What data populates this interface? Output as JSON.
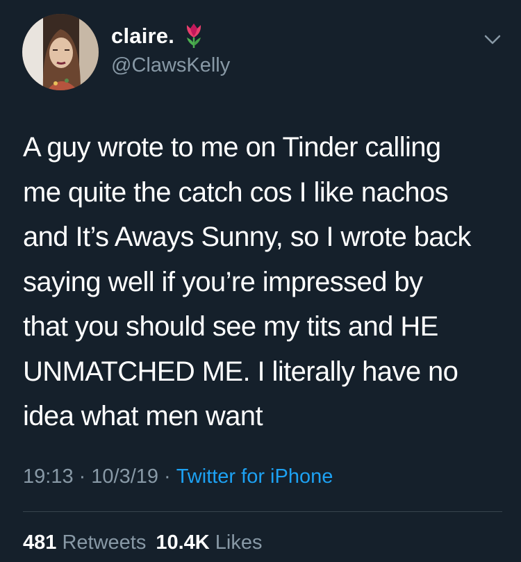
{
  "author": {
    "display_name": "claire.",
    "handle": "@ClawsKelly",
    "emoji_icon": "tulip-icon"
  },
  "tweet": {
    "lines": [
      "A guy wrote to me on Tinder calling",
      "me quite the catch cos I like nachos",
      "and It’s Aways Sunny, so I wrote back",
      "saying well if you’re impressed by",
      "that you should see my tits and HE",
      "UNMATCHED ME. I literally have no",
      "idea what men want"
    ]
  },
  "meta": {
    "time": "19:13",
    "date": "10/3/19",
    "separator": "·",
    "source": "Twitter for iPhone"
  },
  "stats": {
    "retweets_count": "481",
    "retweets_label": "Retweets",
    "likes_count": "10.4K",
    "likes_label": "Likes"
  },
  "colors": {
    "background": "#15202b",
    "secondary_text": "#8899a6",
    "link": "#1da1f2",
    "divider": "#38444d"
  }
}
